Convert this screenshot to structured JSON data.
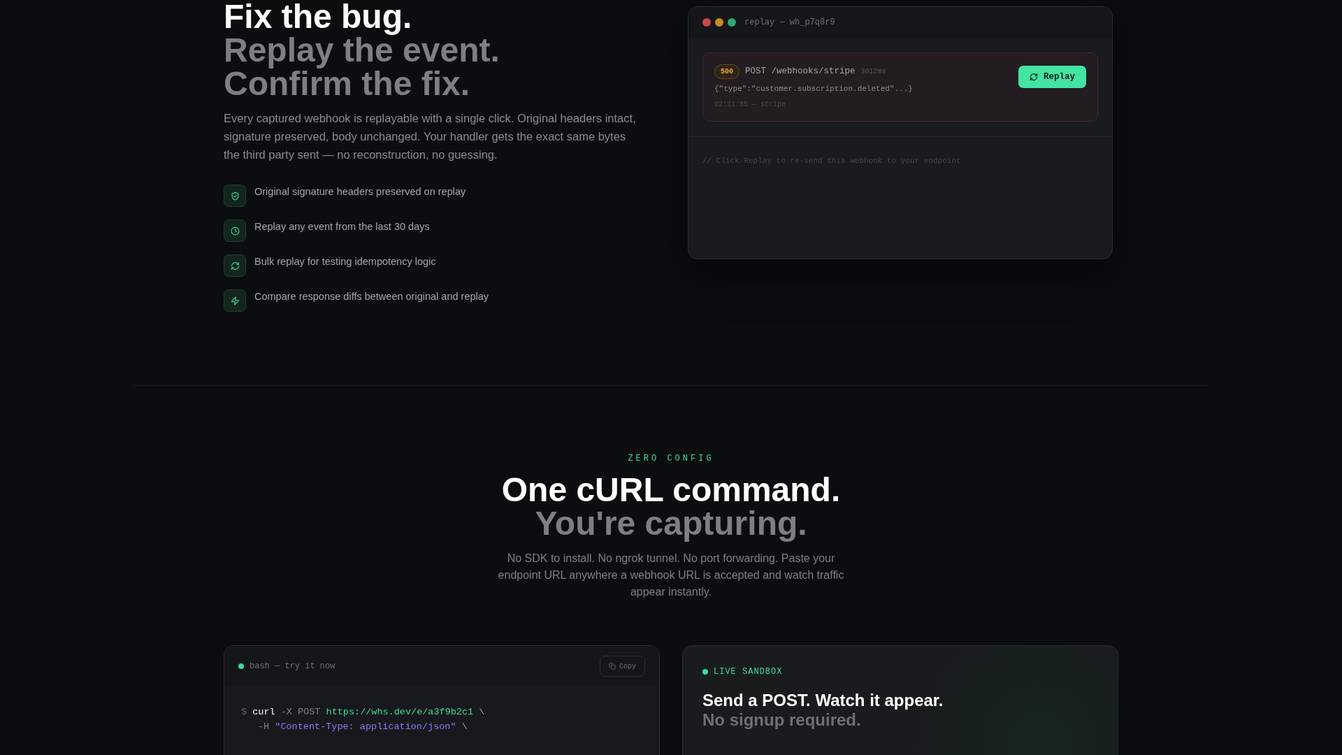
{
  "replay_section": {
    "heading": [
      "Fix the bug.",
      "Replay the event.",
      "Confirm the fix."
    ],
    "description": "Every captured webhook is replayable with a single click. Original headers intact, signature preserved, body unchanged. Your handler gets the exact same bytes the third party sent — no reconstruction, no guessing.",
    "features": [
      {
        "kind": "signature",
        "text": "Original signature headers preserved on replay"
      },
      {
        "kind": "history",
        "text": "Replay any event from the last 30 days"
      },
      {
        "kind": "bulk",
        "text": "Bulk replay for testing idempotency logic"
      },
      {
        "kind": "compare",
        "text": "Compare response diffs between original and replay"
      }
    ],
    "window": {
      "title": "replay — wh_p7q8r9",
      "dots": [
        {
          "color": "#c9474a"
        },
        {
          "color": "#c9891f"
        },
        {
          "color": "#2ea775"
        }
      ],
      "event": {
        "status": "500",
        "method_path": "POST /webhooks/stripe",
        "duration": "3012ms",
        "body": "{\"type\":\"customer.subscription.deleted\"...}",
        "meta": "02:11:55 — stripe"
      },
      "replay_button": "Replay",
      "comment": "// Click Replay to re-send this webhook to your endpoint"
    }
  },
  "config_section": {
    "eyebrow": "ZERO CONFIG",
    "heading": [
      "One cURL command.",
      "You're capturing."
    ],
    "description": "No SDK to install. No ngrok tunnel. No port forwarding. Paste your endpoint URL anywhere a webhook URL is accepted and watch traffic appear instantly.",
    "terminal": {
      "title": "bash — try it now",
      "copy_button": "Copy",
      "lines": [
        [
          {
            "kind": "prompt",
            "text": "$"
          },
          {
            "kind": "command",
            "text": "curl"
          },
          {
            "kind": "flag",
            "text": "-X POST"
          },
          {
            "kind": "url",
            "text": "https://whs.dev/e/a3f9b2c1"
          },
          {
            "kind": "plain",
            "text": "\\"
          }
        ],
        [
          {
            "kind": "flag",
            "text": "-H"
          },
          {
            "kind": "string",
            "text": "\"Content-Type: application/json\""
          },
          {
            "kind": "plain",
            "text": "\\"
          }
        ]
      ]
    },
    "sandbox": {
      "label": "LIVE SANDBOX",
      "heading": [
        "Send a POST. Watch it appear.",
        "No signup required."
      ]
    }
  }
}
